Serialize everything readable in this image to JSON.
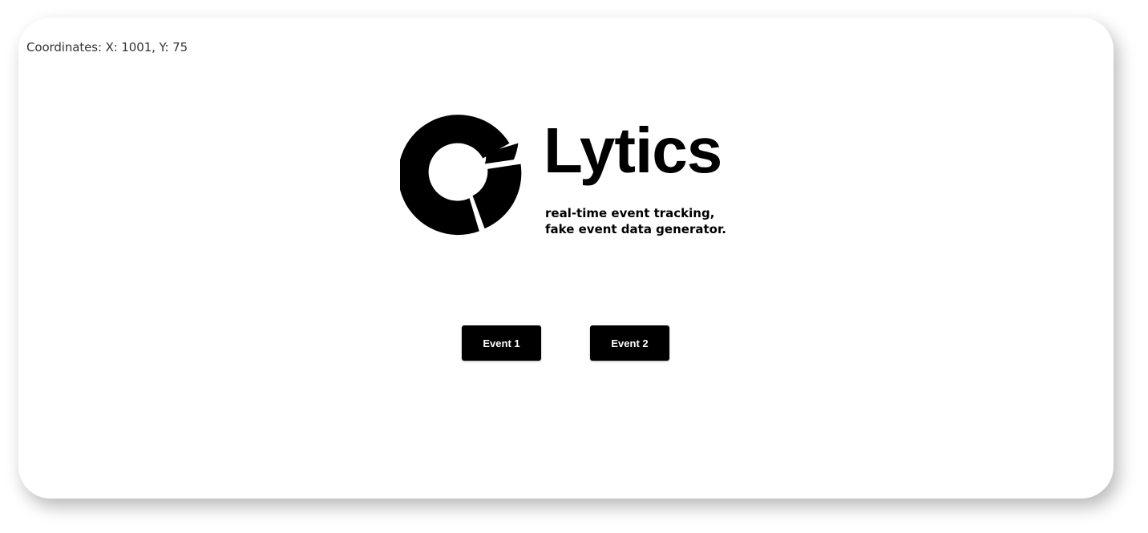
{
  "coordinates": {
    "label": "Coordinates: X: 1001, Y: 75"
  },
  "brand": {
    "title": "Lytics",
    "tagline_line1": "real-time event tracking,",
    "tagline_line2": "fake event data generator.",
    "logo_icon": "donut-chart-icon",
    "logo_color": "#000000"
  },
  "actions": {
    "event1_label": "Event 1",
    "event2_label": "Event 2",
    "button_color": "#000000",
    "button_text_color": "#ffffff"
  }
}
